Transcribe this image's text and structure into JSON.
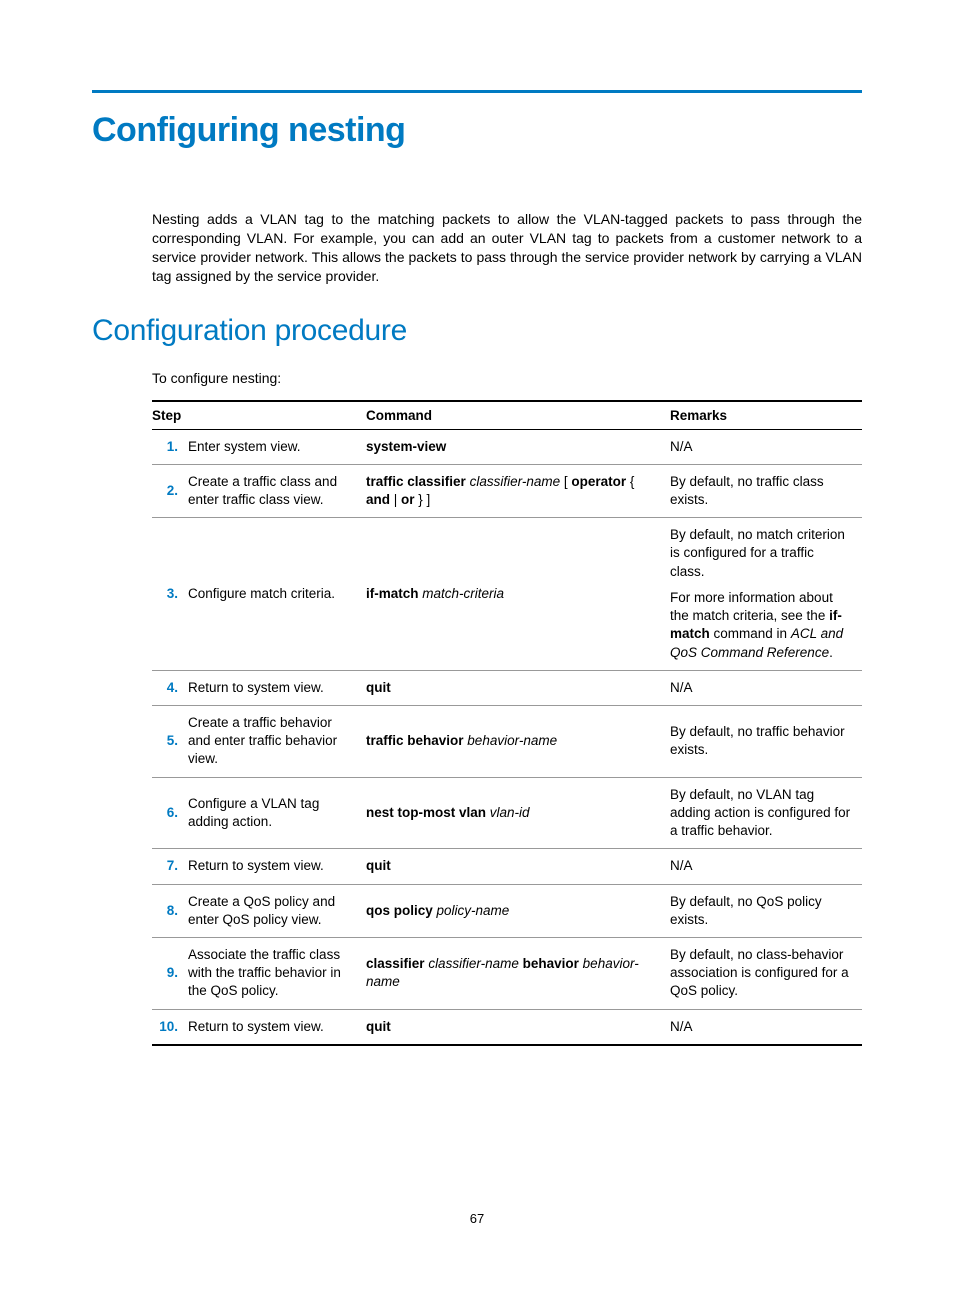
{
  "page": {
    "title": "Configuring nesting",
    "intro": "Nesting adds a VLAN tag to the matching packets to allow the VLAN-tagged packets to pass through the corresponding VLAN. For example, you can add an outer VLAN tag to packets from a customer network to a service provider network. This allows the packets to pass through the service provider network by carrying a VLAN tag assigned by the service provider.",
    "section_heading": "Configuration procedure",
    "lead": "To configure nesting:",
    "table": {
      "headers": {
        "step": "Step",
        "command": "Command",
        "remarks": "Remarks"
      },
      "rows": [
        {
          "n": "1.",
          "step": "Enter system view.",
          "cmd_bold": "system-view",
          "remarks_plain": "N/A"
        },
        {
          "n": "2.",
          "step": "Create a traffic class and enter traffic class view.",
          "cmd_b1": "traffic classifier",
          "cmd_i1": "classifier-name",
          "cmd_p1": " [ ",
          "cmd_b2": "operator",
          "cmd_p2": " { ",
          "cmd_b3": "and",
          "cmd_p3": " | ",
          "cmd_b4": "or",
          "cmd_p4": " } ]",
          "remarks_plain": "By default, no traffic class exists."
        },
        {
          "n": "3.",
          "step": "Configure match criteria.",
          "cmd_b1": "if-match",
          "cmd_i1": "match-criteria",
          "remarks_p1": "By default, no match criterion is configured for a traffic class.",
          "remarks_p2a": "For more information about the match criteria, see the ",
          "remarks_p2b": "if-match",
          "remarks_p2c": " command in ",
          "remarks_p2d": "ACL and QoS Command Reference",
          "remarks_p2e": "."
        },
        {
          "n": "4.",
          "step": "Return to system view.",
          "cmd_bold": "quit",
          "remarks_plain": "N/A"
        },
        {
          "n": "5.",
          "step": "Create a traffic behavior and enter traffic behavior view.",
          "cmd_b1": "traffic behavior",
          "cmd_i1": "behavior-name",
          "remarks_plain": "By default, no traffic behavior exists."
        },
        {
          "n": "6.",
          "step": "Configure a VLAN tag adding action.",
          "cmd_b1": "nest top-most vlan",
          "cmd_i1": "vlan-id",
          "remarks_plain": "By default, no VLAN tag adding action is configured for a traffic behavior."
        },
        {
          "n": "7.",
          "step": "Return to system view.",
          "cmd_bold": "quit",
          "remarks_plain": "N/A"
        },
        {
          "n": "8.",
          "step": "Create a QoS policy and enter QoS policy view.",
          "cmd_b1": "qos policy",
          "cmd_i1": "policy-name",
          "remarks_plain": "By default, no QoS policy exists."
        },
        {
          "n": "9.",
          "step": "Associate the traffic class with the traffic behavior in the QoS policy.",
          "cmd_b1": "classifier",
          "cmd_i1": "classifier-name",
          "cmd_b2_sp": "behavior",
          "cmd_i2": "behavior-name",
          "remarks_plain": "By default, no class-behavior association is configured for a QoS policy."
        },
        {
          "n": "10.",
          "step": "Return to system view.",
          "cmd_bold": "quit",
          "remarks_plain": "N/A"
        }
      ]
    },
    "number": "67"
  }
}
